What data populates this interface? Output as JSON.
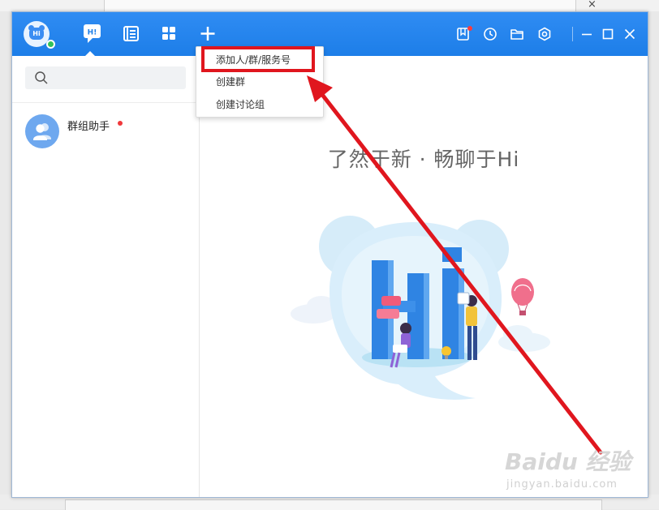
{
  "background": {
    "close_glyph": "×"
  },
  "app": {
    "name": "Hi",
    "avatar_text": "Hi",
    "colors": {
      "titlebar": "#2088ee",
      "accent_red": "#e0161e",
      "unread": "#f0383b",
      "online": "#33c25a"
    },
    "nav": {
      "messages_icon_text": "H!",
      "active": "messages"
    }
  },
  "sidebar": {
    "search": {
      "placeholder": "",
      "value": ""
    },
    "contacts": [
      {
        "name": "群组助手",
        "unread": true
      }
    ]
  },
  "main": {
    "slogan": "了然于新 · 畅聊于Hi"
  },
  "dropdown": {
    "items": [
      {
        "label": "添加人/群/服务号",
        "highlighted": true
      },
      {
        "label": "创建群"
      },
      {
        "label": "创建讨论组"
      }
    ]
  },
  "watermark": {
    "brand": "Baidu 经验",
    "url": "jingyan.baidu.com"
  }
}
